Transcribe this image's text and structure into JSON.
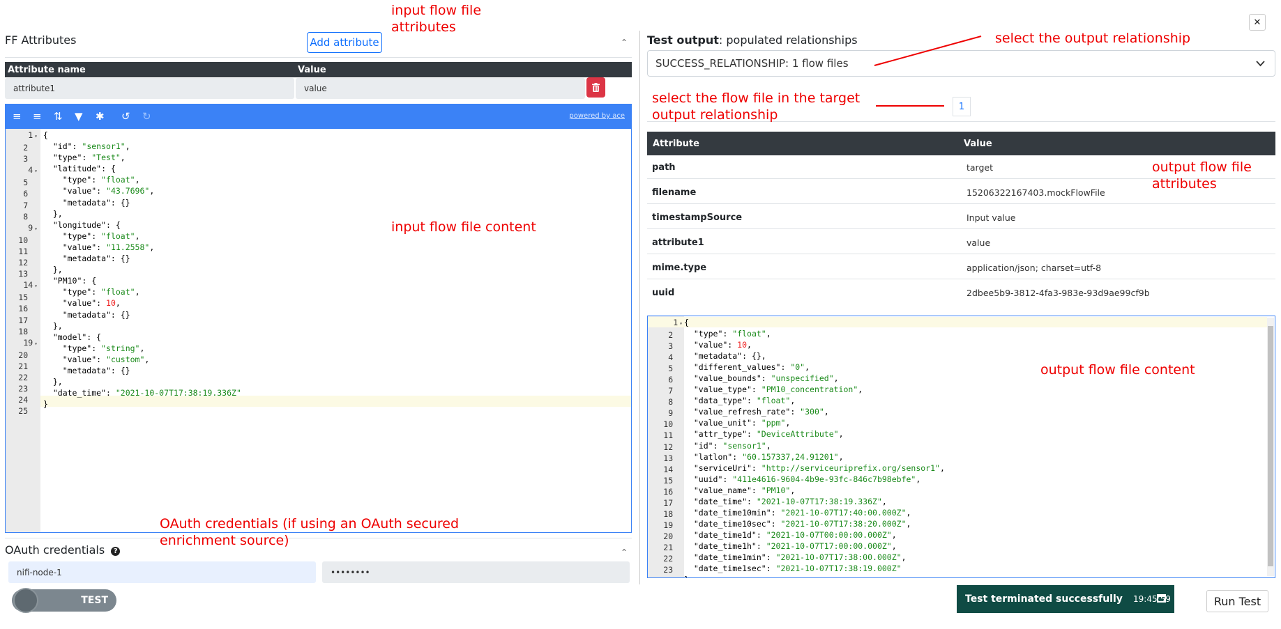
{
  "annotations": {
    "input_attrs_1": "input flow file",
    "input_attrs_2": "attributes",
    "input_content": "input flow file content",
    "oauth_1": "OAuth credentials (if using an OAuth secured",
    "oauth_2": "enrichment source)",
    "select_rel": "select the output relationship",
    "select_ff_1": "select the flow file in the target",
    "select_ff_2": "output relationship",
    "output_attrs_1": "output flow file",
    "output_attrs_2": "attributes",
    "output_content": "output flow file content"
  },
  "ff_attributes": {
    "title": "FF Attributes",
    "add_button": "Add attribute",
    "col_name": "Attribute name",
    "col_value": "Value",
    "rows": [
      {
        "name": "attribute1",
        "value": "value"
      }
    ]
  },
  "editor": {
    "powered_by": "powered by ace",
    "icons": [
      "indent-icon",
      "wrap-icon",
      "sort-icon",
      "filter-icon",
      "wrench-icon",
      "undo-icon",
      "redo-icon"
    ]
  },
  "oauth": {
    "title": "OAuth credentials",
    "username": "nifi-node-1",
    "password": "••••••••"
  },
  "toggle": {
    "label": "TEST"
  },
  "test_output": {
    "title_bold": "Test output",
    "title_rest": ": populated relationships",
    "relationship": "SUCCESS_RELATIONSHIP: 1 flow files",
    "page": "1",
    "col_attr": "Attribute",
    "col_value": "Value",
    "rows": [
      {
        "k": "path",
        "v": "target"
      },
      {
        "k": "filename",
        "v": "15206322167403.mockFlowFile"
      },
      {
        "k": "timestampSource",
        "v": "Input value"
      },
      {
        "k": "attribute1",
        "v": "value"
      },
      {
        "k": "mime.type",
        "v": "application/json; charset=utf-8"
      },
      {
        "k": "uuid",
        "v": "2dbee5b9-3812-4fa3-983e-93d9ae99cf9b"
      }
    ]
  },
  "toast": {
    "message": "Test terminated successfully",
    "time": "19:45:59"
  },
  "run_button": "Run Test",
  "close_glyph": "✕",
  "colors": {
    "accent": "#0d6efd",
    "editor_toolbar": "#3b82f6",
    "annotation": "#ee0000",
    "toast": "#0f4b44",
    "danger": "#dc3545"
  }
}
